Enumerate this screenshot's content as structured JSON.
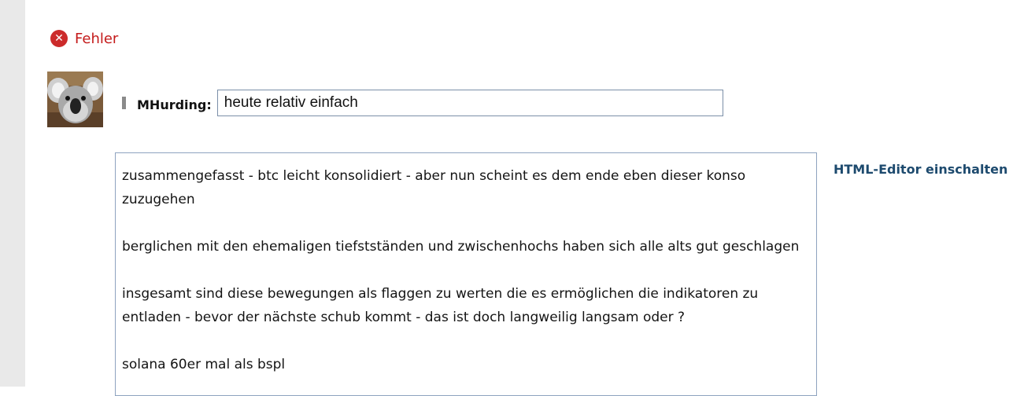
{
  "error": {
    "icon": "error-circle-x-icon",
    "text": "Fehler",
    "color": "#c41a1a"
  },
  "post": {
    "avatar": "koala-avatar",
    "username": "MHurding:",
    "title_value": "heute relativ einfach"
  },
  "editor": {
    "paragraphs": [
      "zusammengefasst - btc leicht konsolidiert - aber nun scheint es dem ende eben dieser konso zuzugehen",
      "berglichen mit den ehemaligen tiefstständen und zwischenhochs haben sich alle alts gut geschlagen",
      "insgesamt sind diese bewegungen als flaggen zu werten die es ermöglichen die indikatoren zu entladen - bevor der nächste schub kommt - das ist doch langweilig langsam oder ?",
      "solana 60er mal als bspl"
    ]
  },
  "html_editor_toggle": "HTML-Editor einschalten"
}
